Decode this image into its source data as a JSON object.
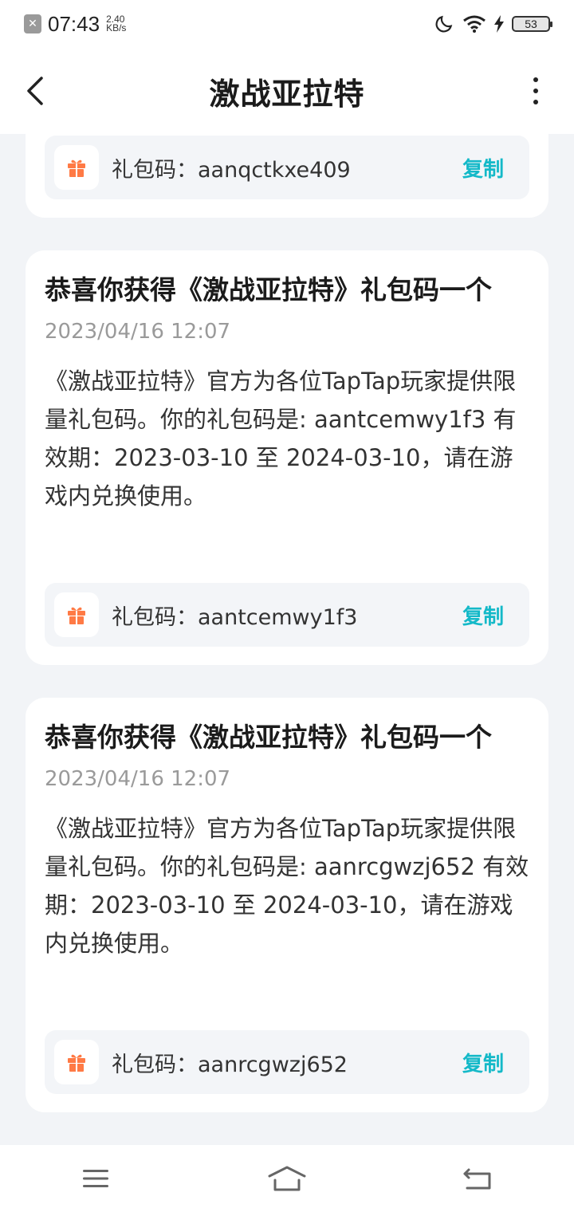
{
  "status_bar": {
    "time": "07:43",
    "speed_value": "2.40",
    "speed_unit": "KB/s",
    "battery": "53"
  },
  "app_bar": {
    "title": "激战亚拉特"
  },
  "cards": [
    {
      "code_label": "礼包码：aanqctkxe409",
      "copy_label": "复制"
    },
    {
      "title": "恭喜你获得《激战亚拉特》礼包码一个",
      "date": "2023/04/16 12:07",
      "body": "《激战亚拉特》官方为各位TapTap玩家提供限量礼包码。你的礼包码是: aantcemwy1f3 有效期：2023-03-10 至 2024-03-10，请在游戏内兑换使用。",
      "code_label": "礼包码：aantcemwy1f3",
      "copy_label": "复制"
    },
    {
      "title": "恭喜你获得《激战亚拉特》礼包码一个",
      "date": "2023/04/16 12:07",
      "body": "《激战亚拉特》官方为各位TapTap玩家提供限量礼包码。你的礼包码是: aanrcgwzj652 有效期：2023-03-10 至 2024-03-10，请在游戏内兑换使用。",
      "code_label": "礼包码：aanrcgwzj652",
      "copy_label": "复制"
    }
  ],
  "colors": {
    "accent": "#14b9c8",
    "gift": "#ff7a45",
    "background": "#f2f4f7"
  }
}
